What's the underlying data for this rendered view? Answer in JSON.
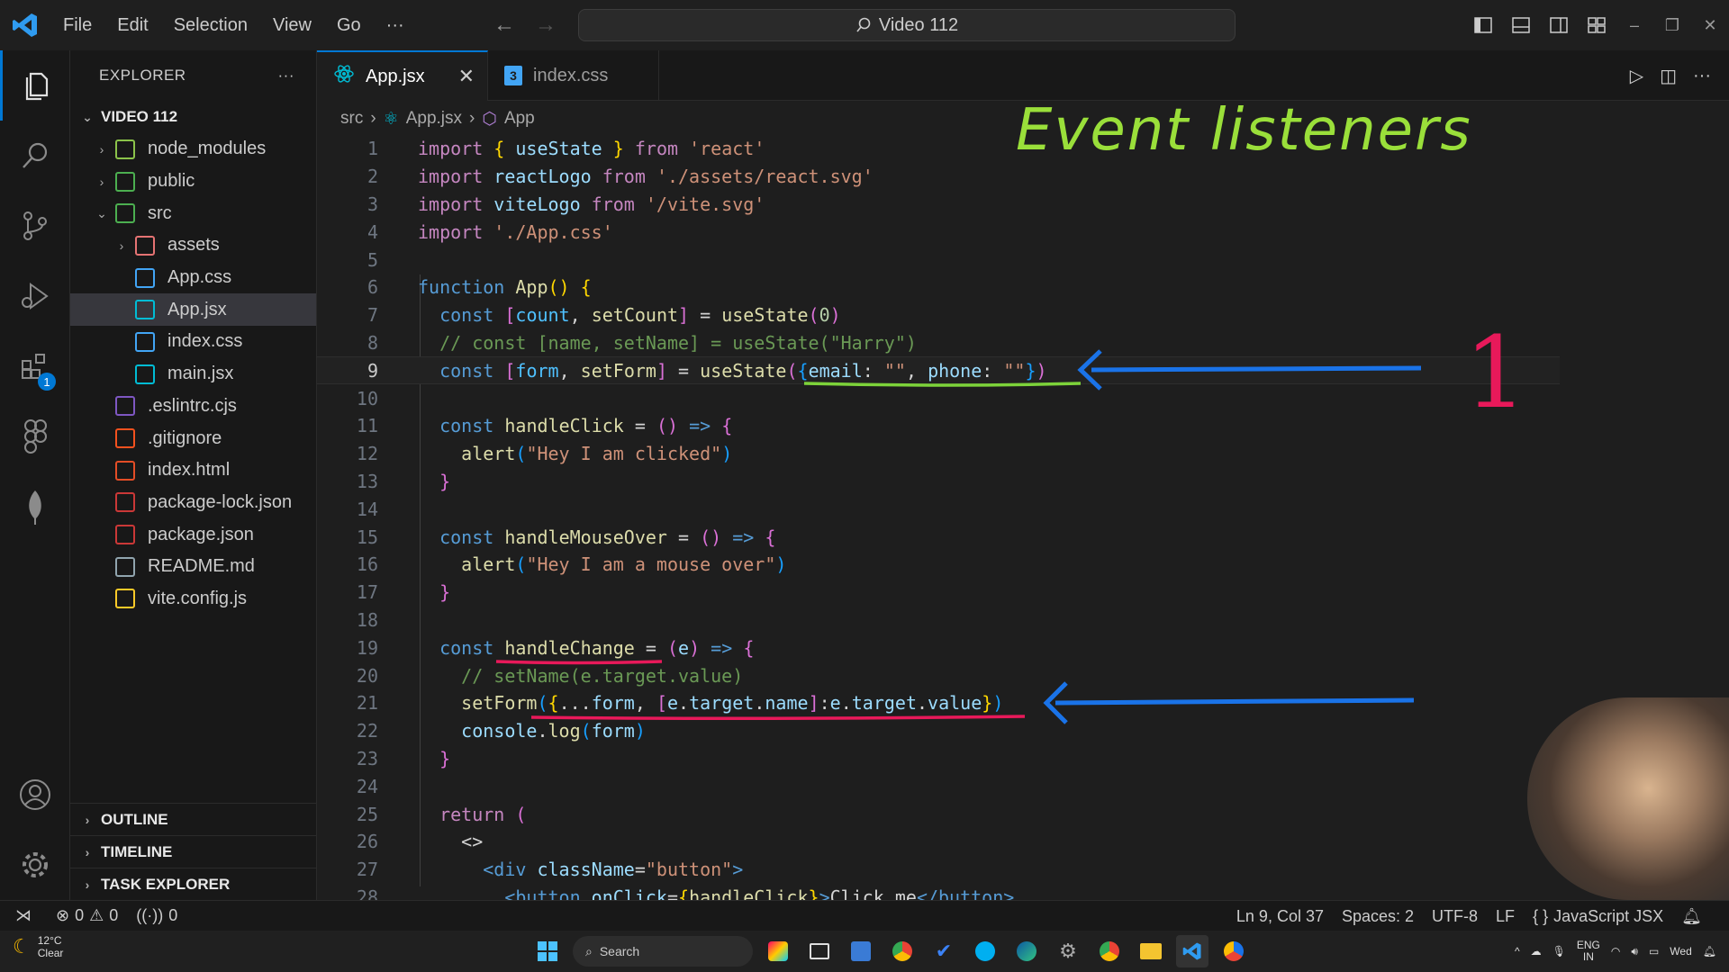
{
  "window": {
    "menu": [
      "File",
      "Edit",
      "Selection",
      "View",
      "Go",
      "···"
    ],
    "search_text": "Video 112"
  },
  "sidebar": {
    "title": "EXPLORER",
    "more": "···",
    "root": "VIDEO 112",
    "tree": [
      {
        "label": "node_modules",
        "indent": 1,
        "chevron": "›",
        "icon": "folder-node-icon",
        "color": "#8bc34a"
      },
      {
        "label": "public",
        "indent": 1,
        "chevron": "›",
        "icon": "folder-public-icon",
        "color": "#4caf50"
      },
      {
        "label": "src",
        "indent": 1,
        "chevron": "⌄",
        "icon": "folder-src-icon",
        "color": "#4caf50"
      },
      {
        "label": "assets",
        "indent": 2,
        "chevron": "›",
        "icon": "folder-assets-icon",
        "color": "#e57373"
      },
      {
        "label": "App.css",
        "indent": 2,
        "chevron": "",
        "icon": "css-file-icon",
        "color": "#42a5f5"
      },
      {
        "label": "App.jsx",
        "indent": 2,
        "chevron": "",
        "icon": "react-file-icon",
        "color": "#00bcd4",
        "selected": true
      },
      {
        "label": "index.css",
        "indent": 2,
        "chevron": "",
        "icon": "css-file-icon",
        "color": "#42a5f5"
      },
      {
        "label": "main.jsx",
        "indent": 2,
        "chevron": "",
        "icon": "react-file-icon",
        "color": "#00bcd4"
      },
      {
        "label": ".eslintrc.cjs",
        "indent": 1,
        "chevron": "",
        "icon": "eslint-file-icon",
        "color": "#7e57c2"
      },
      {
        "label": ".gitignore",
        "indent": 1,
        "chevron": "",
        "icon": "git-file-icon",
        "color": "#f4511e"
      },
      {
        "label": "index.html",
        "indent": 1,
        "chevron": "",
        "icon": "html-file-icon",
        "color": "#e44d26"
      },
      {
        "label": "package-lock.json",
        "indent": 1,
        "chevron": "",
        "icon": "npm-file-icon",
        "color": "#cb3837"
      },
      {
        "label": "package.json",
        "indent": 1,
        "chevron": "",
        "icon": "npm-file-icon",
        "color": "#cb3837"
      },
      {
        "label": "README.md",
        "indent": 1,
        "chevron": "",
        "icon": "markdown-file-icon",
        "color": "#90a4ae"
      },
      {
        "label": "vite.config.js",
        "indent": 1,
        "chevron": "",
        "icon": "vite-file-icon",
        "color": "#ffca28"
      }
    ],
    "sections": [
      "OUTLINE",
      "TIMELINE",
      "TASK EXPLORER"
    ]
  },
  "activity": {
    "extensions_badge": "1"
  },
  "tabs": [
    {
      "label": "App.jsx",
      "active": true,
      "close": "✕"
    },
    {
      "label": "index.css",
      "active": false
    }
  ],
  "breadcrumb": {
    "a": "src",
    "b": "App.jsx",
    "c": "App"
  },
  "code_lines": [
    [
      [
        "kw",
        "import"
      ],
      [
        "plain",
        " "
      ],
      [
        "brk1",
        "{"
      ],
      [
        "plain",
        " "
      ],
      [
        "var",
        "useState"
      ],
      [
        "plain",
        " "
      ],
      [
        "brk1",
        "}"
      ],
      [
        "plain",
        " "
      ],
      [
        "kw",
        "from"
      ],
      [
        "plain",
        " "
      ],
      [
        "str",
        "'react'"
      ]
    ],
    [
      [
        "kw",
        "import"
      ],
      [
        "plain",
        " "
      ],
      [
        "var",
        "reactLogo"
      ],
      [
        "plain",
        " "
      ],
      [
        "kw",
        "from"
      ],
      [
        "plain",
        " "
      ],
      [
        "str",
        "'./assets/react.svg'"
      ]
    ],
    [
      [
        "kw",
        "import"
      ],
      [
        "plain",
        " "
      ],
      [
        "var",
        "viteLogo"
      ],
      [
        "plain",
        " "
      ],
      [
        "kw",
        "from"
      ],
      [
        "plain",
        " "
      ],
      [
        "str",
        "'/vite.svg'"
      ]
    ],
    [
      [
        "kw",
        "import"
      ],
      [
        "plain",
        " "
      ],
      [
        "str",
        "'./App.css'"
      ]
    ],
    [],
    [
      [
        "dkw",
        "function"
      ],
      [
        "plain",
        " "
      ],
      [
        "fn",
        "App"
      ],
      [
        "brk1",
        "()"
      ],
      [
        "plain",
        " "
      ],
      [
        "brk1",
        "{"
      ]
    ],
    [
      [
        "plain",
        "  "
      ],
      [
        "dkw",
        "const"
      ],
      [
        "plain",
        " "
      ],
      [
        "brk2",
        "["
      ],
      [
        "cst",
        "count"
      ],
      [
        "plain",
        ", "
      ],
      [
        "fn",
        "setCount"
      ],
      [
        "brk2",
        "]"
      ],
      [
        "plain",
        " = "
      ],
      [
        "fn",
        "useState"
      ],
      [
        "brk2",
        "("
      ],
      [
        "num",
        "0"
      ],
      [
        "brk2",
        ")"
      ]
    ],
    [
      [
        "plain",
        "  "
      ],
      [
        "cmt",
        "// const [name, setName] = useState(\"Harry\")"
      ]
    ],
    [
      [
        "plain",
        "  "
      ],
      [
        "dkw",
        "const"
      ],
      [
        "plain",
        " "
      ],
      [
        "brk2",
        "["
      ],
      [
        "cst",
        "form"
      ],
      [
        "plain",
        ", "
      ],
      [
        "fn",
        "setForm"
      ],
      [
        "brk2",
        "]"
      ],
      [
        "plain",
        " = "
      ],
      [
        "fn",
        "useState"
      ],
      [
        "brk2",
        "("
      ],
      [
        "brk3",
        "{"
      ],
      [
        "var",
        "email"
      ],
      [
        "plain",
        ": "
      ],
      [
        "str",
        "\"\""
      ],
      [
        "plain",
        ", "
      ],
      [
        "var",
        "phone"
      ],
      [
        "plain",
        ": "
      ],
      [
        "str",
        "\"\""
      ],
      [
        "brk3",
        "}"
      ],
      [
        "brk2",
        ")"
      ]
    ],
    [],
    [
      [
        "plain",
        "  "
      ],
      [
        "dkw",
        "const"
      ],
      [
        "plain",
        " "
      ],
      [
        "fn",
        "handleClick"
      ],
      [
        "plain",
        " = "
      ],
      [
        "brk2",
        "()"
      ],
      [
        "plain",
        " "
      ],
      [
        "dkw",
        "=>"
      ],
      [
        "plain",
        " "
      ],
      [
        "brk2",
        "{"
      ]
    ],
    [
      [
        "plain",
        "    "
      ],
      [
        "fn",
        "alert"
      ],
      [
        "brk3",
        "("
      ],
      [
        "str",
        "\"Hey I am clicked\""
      ],
      [
        "brk3",
        ")"
      ]
    ],
    [
      [
        "plain",
        "  "
      ],
      [
        "brk2",
        "}"
      ]
    ],
    [],
    [
      [
        "plain",
        "  "
      ],
      [
        "dkw",
        "const"
      ],
      [
        "plain",
        " "
      ],
      [
        "fn",
        "handleMouseOver"
      ],
      [
        "plain",
        " = "
      ],
      [
        "brk2",
        "()"
      ],
      [
        "plain",
        " "
      ],
      [
        "dkw",
        "=>"
      ],
      [
        "plain",
        " "
      ],
      [
        "brk2",
        "{"
      ]
    ],
    [
      [
        "plain",
        "    "
      ],
      [
        "fn",
        "alert"
      ],
      [
        "brk3",
        "("
      ],
      [
        "str",
        "\"Hey I am a mouse over\""
      ],
      [
        "brk3",
        ")"
      ]
    ],
    [
      [
        "plain",
        "  "
      ],
      [
        "brk2",
        "}"
      ]
    ],
    [],
    [
      [
        "plain",
        "  "
      ],
      [
        "dkw",
        "const"
      ],
      [
        "plain",
        " "
      ],
      [
        "fn",
        "handleChange"
      ],
      [
        "plain",
        " = "
      ],
      [
        "brk2",
        "("
      ],
      [
        "var",
        "e"
      ],
      [
        "brk2",
        ")"
      ],
      [
        "plain",
        " "
      ],
      [
        "dkw",
        "=>"
      ],
      [
        "plain",
        " "
      ],
      [
        "brk2",
        "{"
      ]
    ],
    [
      [
        "plain",
        "    "
      ],
      [
        "cmt",
        "// setName(e.target.value)"
      ]
    ],
    [
      [
        "plain",
        "    "
      ],
      [
        "fn",
        "setForm"
      ],
      [
        "brk3",
        "("
      ],
      [
        "brk1",
        "{"
      ],
      [
        "plain",
        "..."
      ],
      [
        "var",
        "form"
      ],
      [
        "plain",
        ", "
      ],
      [
        "brk2",
        "["
      ],
      [
        "var",
        "e"
      ],
      [
        "plain",
        "."
      ],
      [
        "var",
        "target"
      ],
      [
        "plain",
        "."
      ],
      [
        "var",
        "name"
      ],
      [
        "brk2",
        "]"
      ],
      [
        "plain",
        ":"
      ],
      [
        "var",
        "e"
      ],
      [
        "plain",
        "."
      ],
      [
        "var",
        "target"
      ],
      [
        "plain",
        "."
      ],
      [
        "var",
        "value"
      ],
      [
        "brk1",
        "}"
      ],
      [
        "brk3",
        ")"
      ]
    ],
    [
      [
        "plain",
        "    "
      ],
      [
        "var",
        "console"
      ],
      [
        "plain",
        "."
      ],
      [
        "fn",
        "log"
      ],
      [
        "brk3",
        "("
      ],
      [
        "var",
        "form"
      ],
      [
        "brk3",
        ")"
      ]
    ],
    [
      [
        "plain",
        "  "
      ],
      [
        "brk2",
        "}"
      ]
    ],
    [],
    [
      [
        "plain",
        "  "
      ],
      [
        "kw",
        "return"
      ],
      [
        "plain",
        " "
      ],
      [
        "brk2",
        "("
      ]
    ],
    [
      [
        "plain",
        "    "
      ],
      [
        "plain",
        "<>"
      ]
    ],
    [
      [
        "plain",
        "      "
      ],
      [
        "tag",
        "<div"
      ],
      [
        "plain",
        " "
      ],
      [
        "attr",
        "className"
      ],
      [
        "plain",
        "="
      ],
      [
        "str",
        "\"button\""
      ],
      [
        "tag",
        ">"
      ]
    ],
    [
      [
        "plain",
        "        "
      ],
      [
        "tag",
        "<button"
      ],
      [
        "plain",
        " "
      ],
      [
        "attr",
        "onClick"
      ],
      [
        "plain",
        "="
      ],
      [
        "brk1",
        "{"
      ],
      [
        "fn",
        "handleClick"
      ],
      [
        "brk1",
        "}"
      ],
      [
        "tag",
        ">"
      ],
      [
        "plain",
        "Click me"
      ],
      [
        "tag",
        "</button>"
      ]
    ]
  ],
  "annotations": {
    "title": "Event listeners",
    "number": "1"
  },
  "status": {
    "errors": "0",
    "warnings": "0",
    "ports": "0",
    "position": "Ln 9, Col 37",
    "spaces": "Spaces: 2",
    "encoding": "UTF-8",
    "eol": "LF",
    "language": "JavaScript JSX"
  },
  "taskbar": {
    "temp": "12°C",
    "weather": "Clear",
    "search": "Search",
    "lang1": "ENG",
    "lang2": "IN",
    "day": "Wed"
  }
}
